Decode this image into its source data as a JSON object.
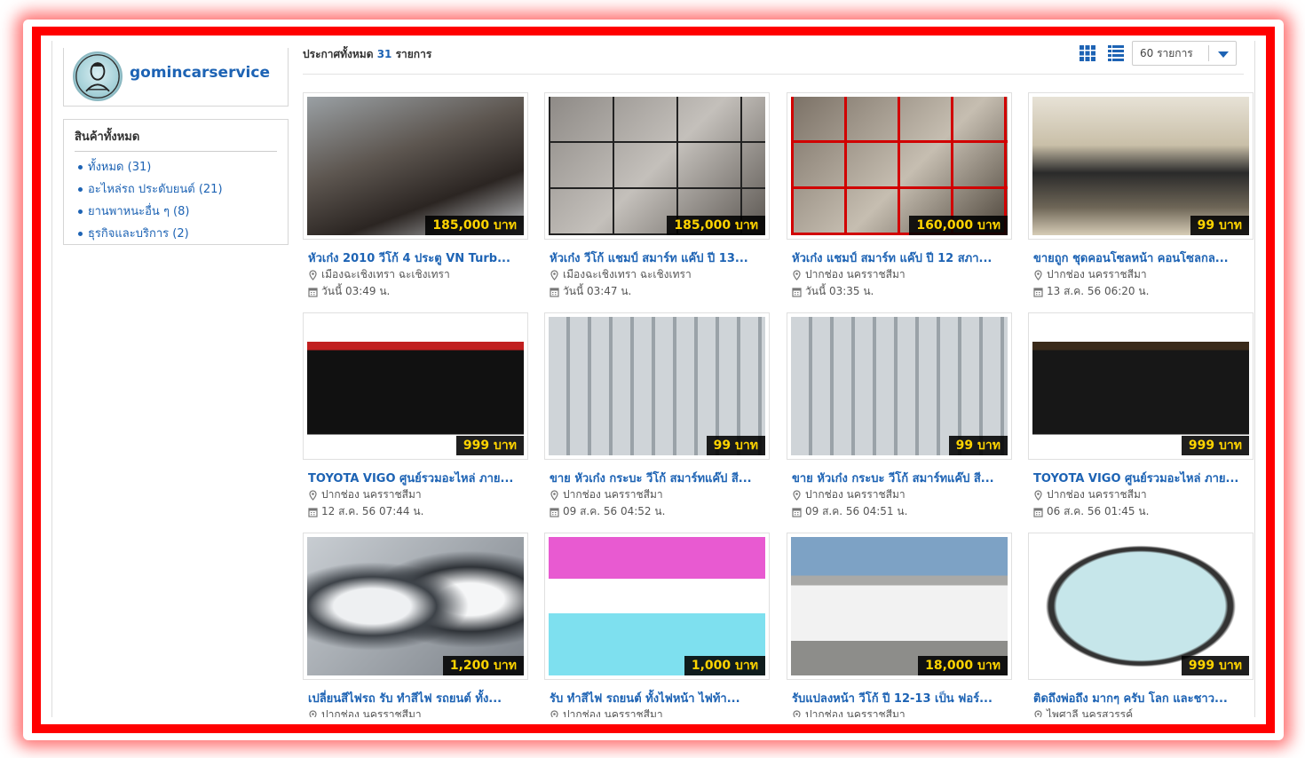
{
  "shop": {
    "name": "gomincarservice"
  },
  "categories": {
    "title": "สินค้าทั้งหมด",
    "items": [
      {
        "label": "ทั้งหมด (31)"
      },
      {
        "label": "อะไหล่รถ ประดับยนต์ (21)"
      },
      {
        "label": "ยานพาหนะอื่น ๆ (8)"
      },
      {
        "label": "ธุรกิจและบริการ (2)"
      }
    ]
  },
  "toolbar": {
    "count_prefix": "ประกาศทั้งหมด",
    "count_value": "31",
    "count_suffix": "รายการ",
    "per_page": "60 รายการ"
  },
  "listings": [
    {
      "title": "หัวเก๋ง 2010 วีโก้ 4 ประตู VN Turb...",
      "price": "185,000 บาท",
      "location": "เมืองฉะเชิงเทรา ฉะเชิงเทรา",
      "date": "วันนี้ 03:49 น."
    },
    {
      "title": "หัวเก๋ง วีโก้ แชมป์ สมาร์ท แค๊ป ปี 13...",
      "price": "185,000 บาท",
      "location": "เมืองฉะเชิงเทรา ฉะเชิงเทรา",
      "date": "วันนี้ 03:47 น."
    },
    {
      "title": "หัวเก๋ง แชมป์ สมาร์ท แค๊ป ปี 12 สภา...",
      "price": "160,000 บาท",
      "location": "ปากช่อง นครราชสีมา",
      "date": "วันนี้ 03:35 น."
    },
    {
      "title": "ขายถูก ชุดคอนโซลหน้า คอนโซลกล...",
      "price": "99 บาท",
      "location": "ปากช่อง นครราชสีมา",
      "date": "13 ส.ค. 56 06:20 น."
    },
    {
      "title": "TOYOTA VIGO ศูนย์รวมอะไหล่ ภาย...",
      "price": "999 บาท",
      "location": "ปากช่อง นครราชสีมา",
      "date": "12 ส.ค. 56 07:44 น."
    },
    {
      "title": "ขาย หัวเก๋ง กระบะ วีโก้ สมาร์ทแค๊ป สี...",
      "price": "99 บาท",
      "location": "ปากช่อง นครราชสีมา",
      "date": "09 ส.ค. 56 04:52 น."
    },
    {
      "title": "ขาย หัวเก๋ง กระบะ วีโก้ สมาร์ทแค๊ป สี...",
      "price": "99 บาท",
      "location": "ปากช่อง นครราชสีมา",
      "date": "09 ส.ค. 56 04:51 น."
    },
    {
      "title": "TOYOTA VIGO ศูนย์รวมอะไหล่ ภาย...",
      "price": "999 บาท",
      "location": "ปากช่อง นครราชสีมา",
      "date": "06 ส.ค. 56 01:45 น."
    },
    {
      "title": "เปลี่ยนสีไฟรถ รับ ทำสีไฟ รถยนต์ ทั้ง...",
      "price": "1,200 บาท",
      "location": "ปากช่อง นครราชสีมา",
      "date": ""
    },
    {
      "title": "รับ ทำสีไฟ รถยนต์ ทั้งไฟหน้า ไฟท้า...",
      "price": "1,000 บาท",
      "location": "ปากช่อง นครราชสีมา",
      "date": ""
    },
    {
      "title": "รับแปลงหน้า วีโก้ ปี 12-13 เป็น ฟอร์...",
      "price": "18,000 บาท",
      "location": "ปากช่อง นครราชสีมา",
      "date": ""
    },
    {
      "title": "ติดถึงพ่อถึง มากๆ ครับ โลก และชาว...",
      "price": "999 บาท",
      "location": "ไพศาลี นครสวรรค์",
      "date": ""
    }
  ]
}
